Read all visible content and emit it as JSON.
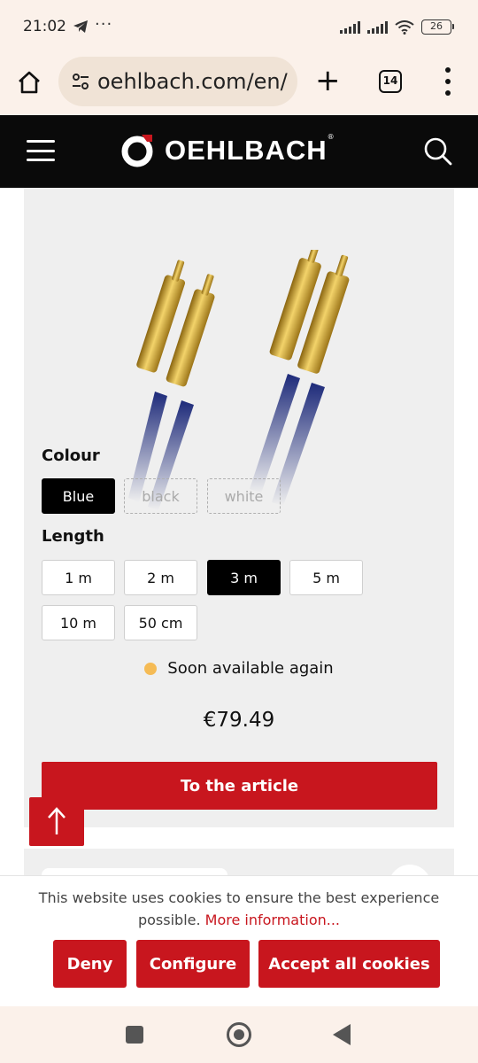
{
  "status_bar": {
    "time": "21:02",
    "more_indicator": "···",
    "battery": "26",
    "icons": [
      "telegram-icon",
      "signal-icon",
      "signal-icon",
      "wifi-icon",
      "battery-icon"
    ]
  },
  "browser": {
    "url": "oehlbach.com/en/",
    "tab_count": "14",
    "icons": [
      "home-icon",
      "site-settings-icon",
      "new-tab-plus-icon",
      "tabs-icon",
      "more-menu-icon"
    ]
  },
  "site_header": {
    "brand": "OEHLBACH",
    "registered": "®",
    "icons": [
      "hamburger-menu-icon",
      "oehlbach-logo-icon",
      "search-icon"
    ]
  },
  "product": {
    "colour_label": "Colour",
    "colours": [
      {
        "label": "Blue",
        "state": "selected"
      },
      {
        "label": "black",
        "state": "disabled"
      },
      {
        "label": "white",
        "state": "disabled"
      }
    ],
    "length_label": "Length",
    "lengths": [
      {
        "label": "1 m",
        "state": "default"
      },
      {
        "label": "2 m",
        "state": "default"
      },
      {
        "label": "3 m",
        "state": "selected"
      },
      {
        "label": "5 m",
        "state": "default"
      },
      {
        "label": "10 m",
        "state": "default"
      },
      {
        "label": "50 cm",
        "state": "default"
      }
    ],
    "availability": "Soon available again",
    "availability_color": "#f5bb55",
    "price": "€79.49",
    "cta": "To the article"
  },
  "scroll_to_top": {
    "icon": "arrow-up-icon"
  },
  "cookie_banner": {
    "text": "This website uses cookies to ensure the best experience possible.",
    "link": "More information...",
    "buttons": {
      "deny": "Deny",
      "configure": "Configure",
      "accept": "Accept all cookies"
    }
  },
  "nav_bar": {
    "icons": [
      "recents-square-icon",
      "home-circle-icon",
      "back-triangle-icon"
    ]
  },
  "colors": {
    "brand_red": "#c8161e",
    "header_black": "#0a0a0a",
    "chrome_bg": "#fbf1ea",
    "card_bg": "#efefef"
  }
}
